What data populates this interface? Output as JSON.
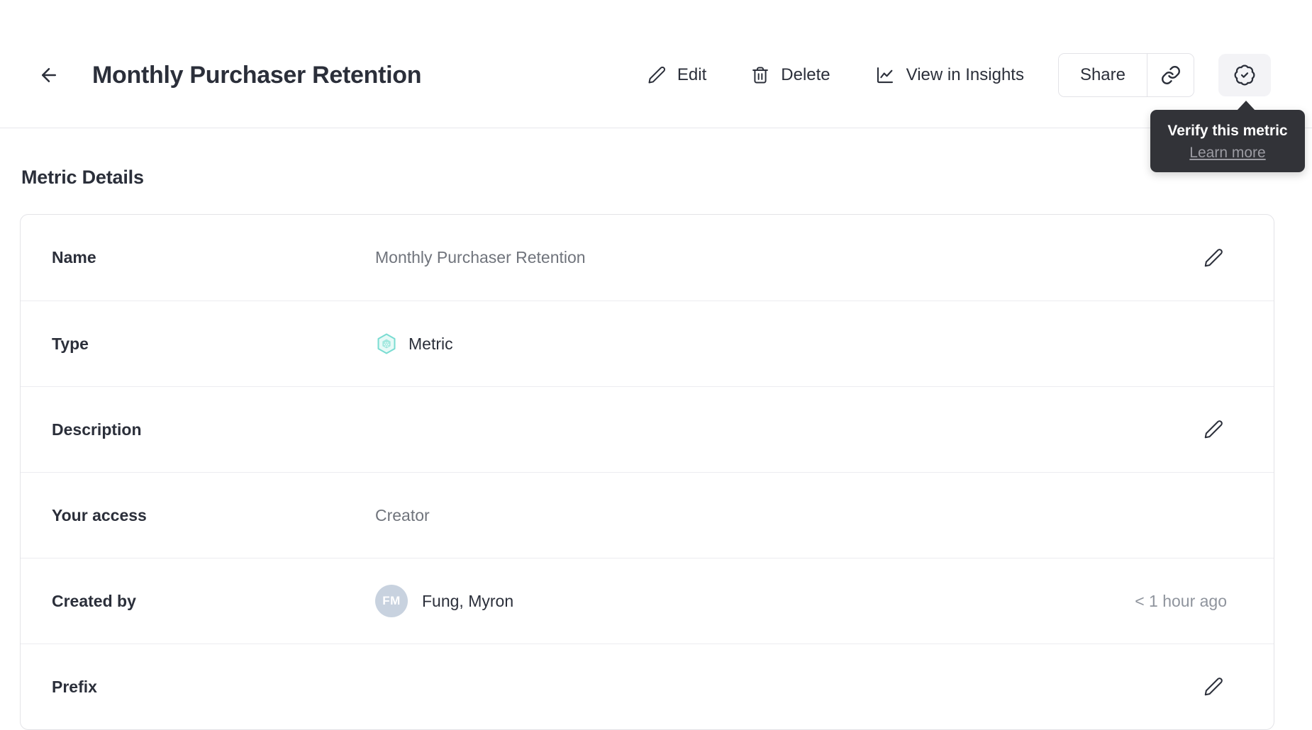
{
  "header": {
    "title": "Monthly Purchaser Retention",
    "actions": {
      "edit": "Edit",
      "delete": "Delete",
      "view_in_insights": "View in Insights",
      "share": "Share"
    },
    "icons": {
      "back": "arrow-left-icon",
      "edit": "pencil-icon",
      "delete": "trash-icon",
      "view_in_insights": "line-chart-icon",
      "copy_link": "link-icon",
      "verify": "verified-badge-icon",
      "type_metric": "metric-hexagon-icon",
      "row_edit": "pencil-icon"
    }
  },
  "tooltip": {
    "title": "Verify this metric",
    "link_label": "Learn more"
  },
  "section_title": "Metric Details",
  "details": {
    "rows": [
      {
        "label": "Name",
        "value": "Monthly Purchaser Retention"
      },
      {
        "label": "Type",
        "value": "Metric"
      },
      {
        "label": "Description",
        "value": ""
      },
      {
        "label": "Your access",
        "value": "Creator"
      },
      {
        "label": "Created by",
        "value": "Fung, Myron",
        "avatar_initials": "FM",
        "meta": "< 1 hour ago"
      },
      {
        "label": "Prefix",
        "value": ""
      }
    ]
  },
  "colors": {
    "accent_teal": "#7ADCD2",
    "accent_teal_fill": "#E7FAF7",
    "accent_teal_inner": "#A3E8DF",
    "avatar_bg": "#C8D2DF",
    "tooltip_bg": "#323338",
    "text_dark": "#2B2F3A",
    "text_gray": "#70747C",
    "border_gray": "#E3E3E7"
  }
}
